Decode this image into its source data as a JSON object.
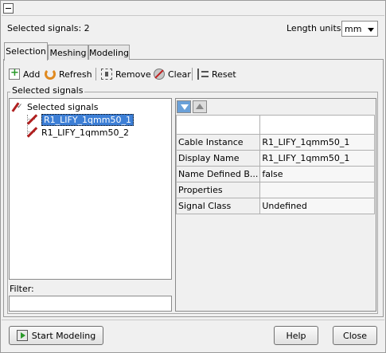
{
  "header": {
    "selected_count": "Selected signals: 2",
    "units_label": "Length units:",
    "units_value": "mm"
  },
  "tabs": [
    {
      "label": "Selection",
      "active": true
    },
    {
      "label": "Meshing",
      "active": false
    },
    {
      "label": "Modeling",
      "active": false
    }
  ],
  "toolbar": {
    "add": "Add",
    "refresh": "Refresh",
    "remove": "Remove",
    "clear": "Clear",
    "reset": "Reset"
  },
  "group_title": "Selected signals",
  "tree": {
    "root": "Selected signals",
    "items": [
      {
        "label": "R1_LIFY_1qmm50_1",
        "selected": true
      },
      {
        "label": "R1_LIFY_1qmm50_2",
        "selected": false
      }
    ]
  },
  "filter": {
    "label": "Filter:",
    "value": ""
  },
  "properties": [
    {
      "key": "Cable Instance",
      "value": "R1_LIFY_1qmm50_1"
    },
    {
      "key": "Display Name",
      "value": "R1_LIFY_1qmm50_1"
    },
    {
      "key": "Name Defined B...",
      "value": "false"
    },
    {
      "key": "Properties",
      "value": ""
    },
    {
      "key": "Signal Class",
      "value": "Undefined"
    }
  ],
  "footer": {
    "start_modeling": "Start Modeling",
    "help": "Help",
    "close": "Close"
  }
}
